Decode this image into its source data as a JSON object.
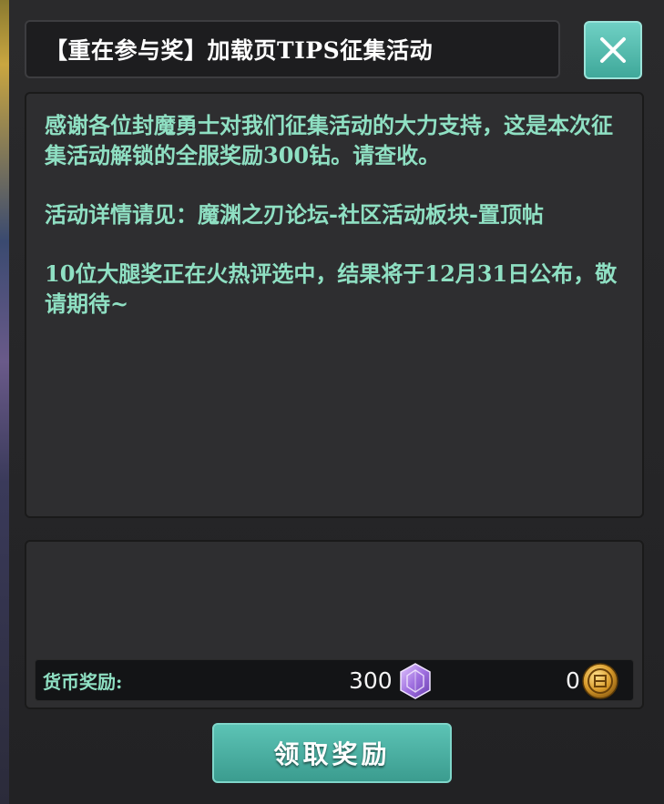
{
  "dialog": {
    "title": "【重在参与奖】加载页TIPS征集活动",
    "close_icon": "close-icon"
  },
  "content": {
    "paragraphs": [
      "感谢各位封魔勇士对我们征集活动的大力支持，这是本次征集活动解锁的全服奖励300钻。请查收。",
      "活动详情请见：魔渊之刃论坛-社区活动板块-置顶帖",
      "10位大腿奖正在火热评选中，结果将于12月31日公布，敬请期待~"
    ],
    "text_color": "#8fe0c3"
  },
  "rewards": {
    "label": "货币奖励:",
    "diamond_amount": "300",
    "diamond_icon": "diamond-icon",
    "gold_amount": "0",
    "gold_icon": "gold-coin-icon"
  },
  "actions": {
    "claim_label": "领取奖励"
  },
  "colors": {
    "accent": "#4fb7a9",
    "panel": "#2e2e30"
  }
}
